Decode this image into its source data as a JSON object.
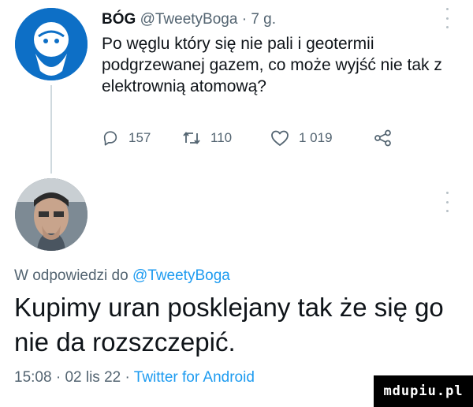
{
  "tweet": {
    "author_name": "BÓG",
    "handle": "@TweetyBoga",
    "separator": "·",
    "time_ago": "7 g.",
    "text": "Po węglu który się nie pali i geotermii podgrzewanej gazem, co może wyjść nie tak z elektrownią atomową?",
    "replies": "157",
    "retweets": "110",
    "likes": "1 019"
  },
  "reply": {
    "replying_to_prefix": "W odpowiedzi do",
    "replying_to_handle": "@TweetyBoga",
    "text": "Kupimy uran posklejany tak że się go nie da rozszczepić.",
    "time": "15:08",
    "separator": "·",
    "date": "02 lis 22",
    "source": "Twitter for Android"
  },
  "watermark": "mdupiu.pl",
  "icons": [
    "reply-icon",
    "retweet-icon",
    "like-icon",
    "share-icon",
    "more-icon"
  ],
  "colors": {
    "link": "#1d9bf0",
    "muted": "#536471",
    "text": "#0f1419"
  }
}
